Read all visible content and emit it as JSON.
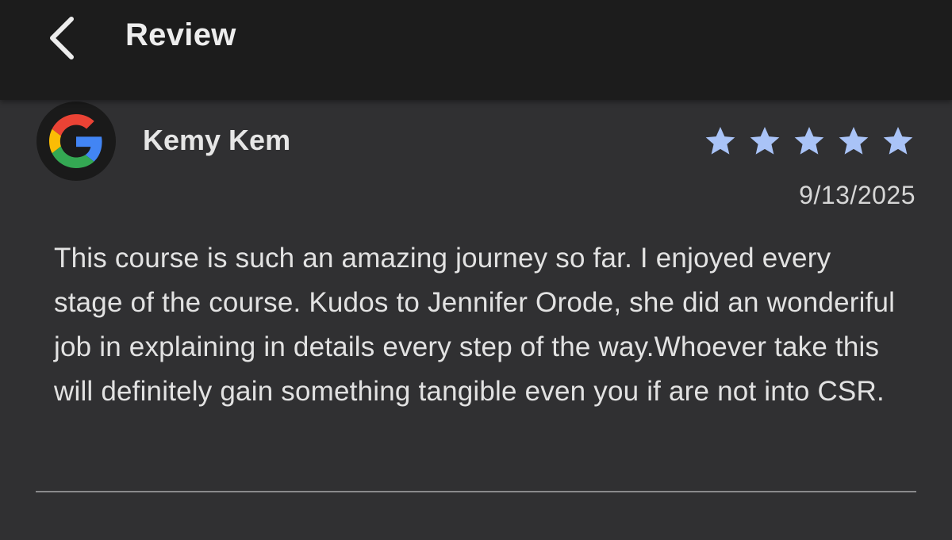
{
  "appbar": {
    "title": "Review",
    "back_icon": "chevron-left-icon"
  },
  "review": {
    "avatar_icon": "google-logo-icon",
    "reviewer_name": "Kemy Kem",
    "rating": 5,
    "rating_max": 5,
    "star_color": "#a9c3f7",
    "date": "9/13/2025",
    "text": "This course is such an amazing journey so far. I enjoyed every stage of the course. Kudos to Jennifer Orode, she did an wonderiful job in explaining in details every step of the way.Whoever take this will definitely gain something tangible even you if are not into CSR."
  },
  "colors": {
    "appbar_bg": "#1c1c1c",
    "page_bg": "#303032",
    "text_primary": "#e2e2e2"
  }
}
